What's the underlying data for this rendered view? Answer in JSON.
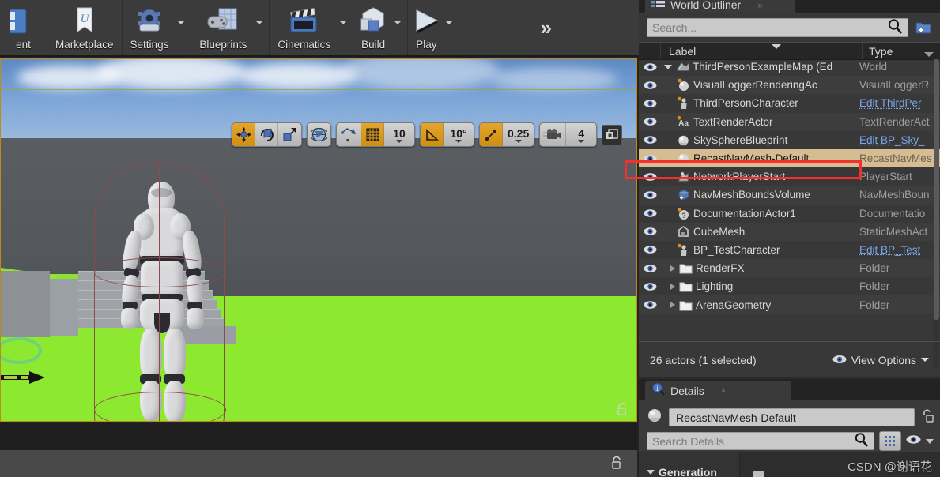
{
  "toolbar": {
    "items": [
      {
        "label": "ent",
        "icon": "content-icon",
        "has_dropdown": false
      },
      {
        "label": "Marketplace",
        "icon": "marketplace-icon",
        "has_dropdown": false
      },
      {
        "label": "Settings",
        "icon": "gear-icon",
        "has_dropdown": true
      },
      {
        "label": "Blueprints",
        "icon": "blueprint-icon",
        "has_dropdown": true
      },
      {
        "label": "Cinematics",
        "icon": "clapperboard-icon",
        "has_dropdown": true
      },
      {
        "label": "Build",
        "icon": "build-icon",
        "has_dropdown": true
      },
      {
        "label": "Play",
        "icon": "play-icon",
        "has_dropdown": true
      }
    ],
    "overflow_label": "»"
  },
  "viewport_toolbar": {
    "transform_modes": [
      {
        "name": "translate-mode",
        "active": true
      },
      {
        "name": "rotate-mode",
        "active": false
      },
      {
        "name": "scale-mode",
        "active": false
      }
    ],
    "coordinate_system": "world-icon",
    "surface_snap": "surface-snap-icon",
    "grid_snap_active": true,
    "grid_snap_value": "10",
    "angle_snap_active": true,
    "angle_snap_value": "10°",
    "scale_snap_active": true,
    "scale_snap_value": "0.25",
    "camera_speed_value": "4",
    "maximize_icon": "maximize-viewport-icon"
  },
  "outliner": {
    "tab_title": "World Outliner",
    "tab_close": "×",
    "search_placeholder": "Search...",
    "add_button_icon": "add-folder-icon",
    "columns": {
      "label": "Label",
      "type": "Type"
    },
    "rows": [
      {
        "label": "ThirdPersonExampleMap (Ed",
        "type": "World",
        "icon": "map-icon",
        "indent": 0,
        "expander": "down",
        "link": false,
        "selected": false
      },
      {
        "label": "VisualLoggerRenderingAc",
        "type": "VisualLoggerR",
        "icon": "actor-sphere-icon",
        "indent": 1,
        "expander": "none",
        "link": false,
        "selected": false
      },
      {
        "label": "ThirdPersonCharacter",
        "type": "Edit ThirdPer",
        "icon": "character-icon",
        "indent": 1,
        "expander": "none",
        "link": true,
        "selected": false
      },
      {
        "label": "TextRenderActor",
        "type": "TextRenderAct",
        "icon": "text-render-icon",
        "indent": 1,
        "expander": "none",
        "link": false,
        "selected": false
      },
      {
        "label": "SkySphereBlueprint",
        "type": "Edit BP_Sky_",
        "icon": "sphere-icon",
        "indent": 1,
        "expander": "none",
        "link": true,
        "selected": false
      },
      {
        "label": "RecastNavMesh-Default",
        "type": "RecastNavMes",
        "icon": "sphere-icon",
        "indent": 1,
        "expander": "none",
        "link": false,
        "selected": true
      },
      {
        "label": "NetworkPlayerStart",
        "type": "PlayerStart",
        "icon": "player-start-icon",
        "indent": 1,
        "expander": "none",
        "link": false,
        "selected": false
      },
      {
        "label": "NavMeshBoundsVolume",
        "type": "NavMeshBoun",
        "icon": "volume-icon",
        "indent": 1,
        "expander": "none",
        "link": false,
        "selected": false
      },
      {
        "label": "DocumentationActor1",
        "type": "Documentatio",
        "icon": "question-actor-icon",
        "indent": 1,
        "expander": "none",
        "link": false,
        "selected": false
      },
      {
        "label": "CubeMesh",
        "type": "StaticMeshAct",
        "icon": "static-mesh-icon",
        "indent": 1,
        "expander": "none",
        "link": false,
        "selected": false
      },
      {
        "label": "BP_TestCharacter",
        "type": "Edit BP_Test",
        "icon": "character-icon",
        "indent": 1,
        "expander": "none",
        "link": true,
        "selected": false
      },
      {
        "label": "RenderFX",
        "type": "Folder",
        "icon": "folder-icon",
        "indent": 1,
        "expander": "right",
        "link": false,
        "selected": false
      },
      {
        "label": "Lighting",
        "type": "Folder",
        "icon": "folder-icon",
        "indent": 1,
        "expander": "right",
        "link": false,
        "selected": false
      },
      {
        "label": "ArenaGeometry",
        "type": "Folder",
        "icon": "folder-icon",
        "indent": 1,
        "expander": "right",
        "link": false,
        "selected": false
      }
    ],
    "footer": {
      "actor_count": "26 actors (1 selected)",
      "view_options": "View Options"
    }
  },
  "details": {
    "tab_title": "Details",
    "tab_close": "×",
    "object_name": "RecastNavMesh-Default",
    "lock_icon": "unlock-icon",
    "search_placeholder": "Search Details",
    "grid_view_icon": "grid-view-icon",
    "eye_icon": "eye-icon",
    "category": "Generation"
  },
  "watermark": "CSDN @谢语花",
  "colors": {
    "selection_highlight": "#d6bc92",
    "annotation_red": "#f4302c",
    "link_blue": "#7ba7e8",
    "accent_orange": "#cf8e12",
    "panel_bg": "#383838",
    "toolbar_bg": "#3b3b3b"
  }
}
